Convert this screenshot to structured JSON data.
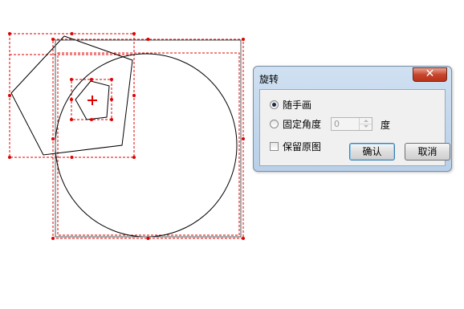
{
  "canvas": {
    "shapes": [
      "big-circle",
      "large-pentagon",
      "small-pentagon"
    ],
    "colors": {
      "stroke": "#000000",
      "selection": "#e00000",
      "handle": "#e00000"
    },
    "rotation_center_icon": "plus-icon"
  },
  "dialog": {
    "title": "旋转",
    "close_icon": "close-icon",
    "freehand_label": "随手画",
    "fixed_angle_label": "固定角度",
    "angle_value": "0",
    "angle_unit": "度",
    "keep_original_label": "保留原图",
    "ok_label": "确认",
    "cancel_label": "取消",
    "freehand_checked": true,
    "fixed_angle_checked": false,
    "keep_original_checked": false
  }
}
